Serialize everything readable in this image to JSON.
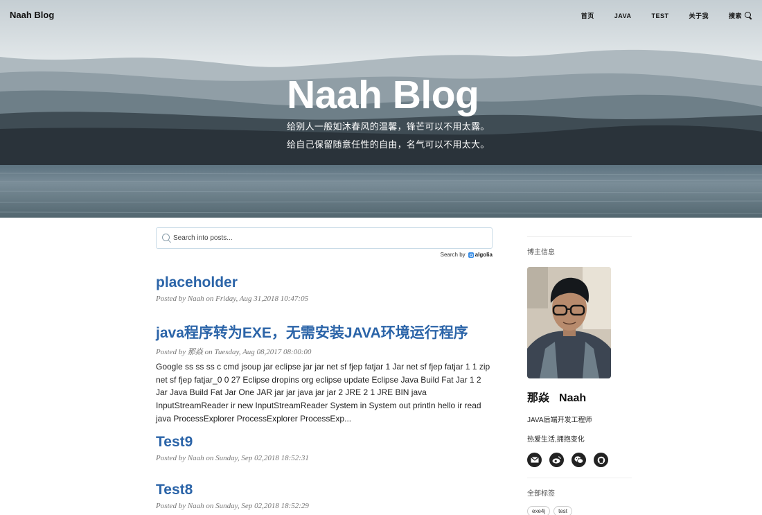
{
  "nav": {
    "brand": "Naah Blog",
    "items": [
      "首页",
      "JAVA",
      "TEST",
      "关于我",
      "搜索"
    ]
  },
  "hero": {
    "title": "Naah Blog",
    "subtitle_line1": "给别人一般如沐春风的温馨，锋芒可以不用太露。",
    "subtitle_line2": "给自己保留随意任性的自由，名气可以不用太大。"
  },
  "search": {
    "placeholder": "Search into posts...",
    "search_by_label": "Search by",
    "provider": "algolia"
  },
  "posts": [
    {
      "title": "placeholder",
      "meta": "Posted by Naah on Friday, Aug 31,2018 10:47:05",
      "excerpt": ""
    },
    {
      "title": "java程序转为EXE，无需安装JAVA环境运行程序",
      "meta": "Posted by 那焱 on Tuesday, Aug 08,2017 08:00:00",
      "excerpt": "Google ss ss ss c cmd jsoup jar eclipse jar jar net sf fjep fatjar 1 Jar net sf fjep fatjar 1 1 zip net sf fjep fatjar_0 0 27 Eclipse dropins org eclipse update Eclipse Java Build Fat Jar 1 2 Jar Java Build Fat Jar One JAR jar jar java jar jar 2 JRE 2 1 JRE BIN java InputStreamReader ir new InputStreamReader System in System out println hello ir read java ProcessExplorer ProcessExplorer ProcessExp..."
    },
    {
      "title": "Test9",
      "meta": "Posted by Naah on Sunday, Sep 02,2018 18:52:31",
      "excerpt": ""
    },
    {
      "title": "Test8",
      "meta": "Posted by Naah on Sunday, Sep 02,2018 18:52:29",
      "excerpt": ""
    }
  ],
  "sidebar": {
    "profile_heading": "博主信息",
    "name_cn": "那焱",
    "name_en": "Naah",
    "role": "JAVA后端开发工程师",
    "motto": "热爱生活,拥抱变化",
    "socials": [
      "envelope-icon",
      "weibo-icon",
      "wechat-icon",
      "github-icon"
    ],
    "tags_heading": "全部标签",
    "tags": [
      "exe4j",
      "test"
    ]
  },
  "colors": {
    "link": "#2b64a8",
    "meta": "#777777",
    "search_border": "#c9dbe7"
  }
}
